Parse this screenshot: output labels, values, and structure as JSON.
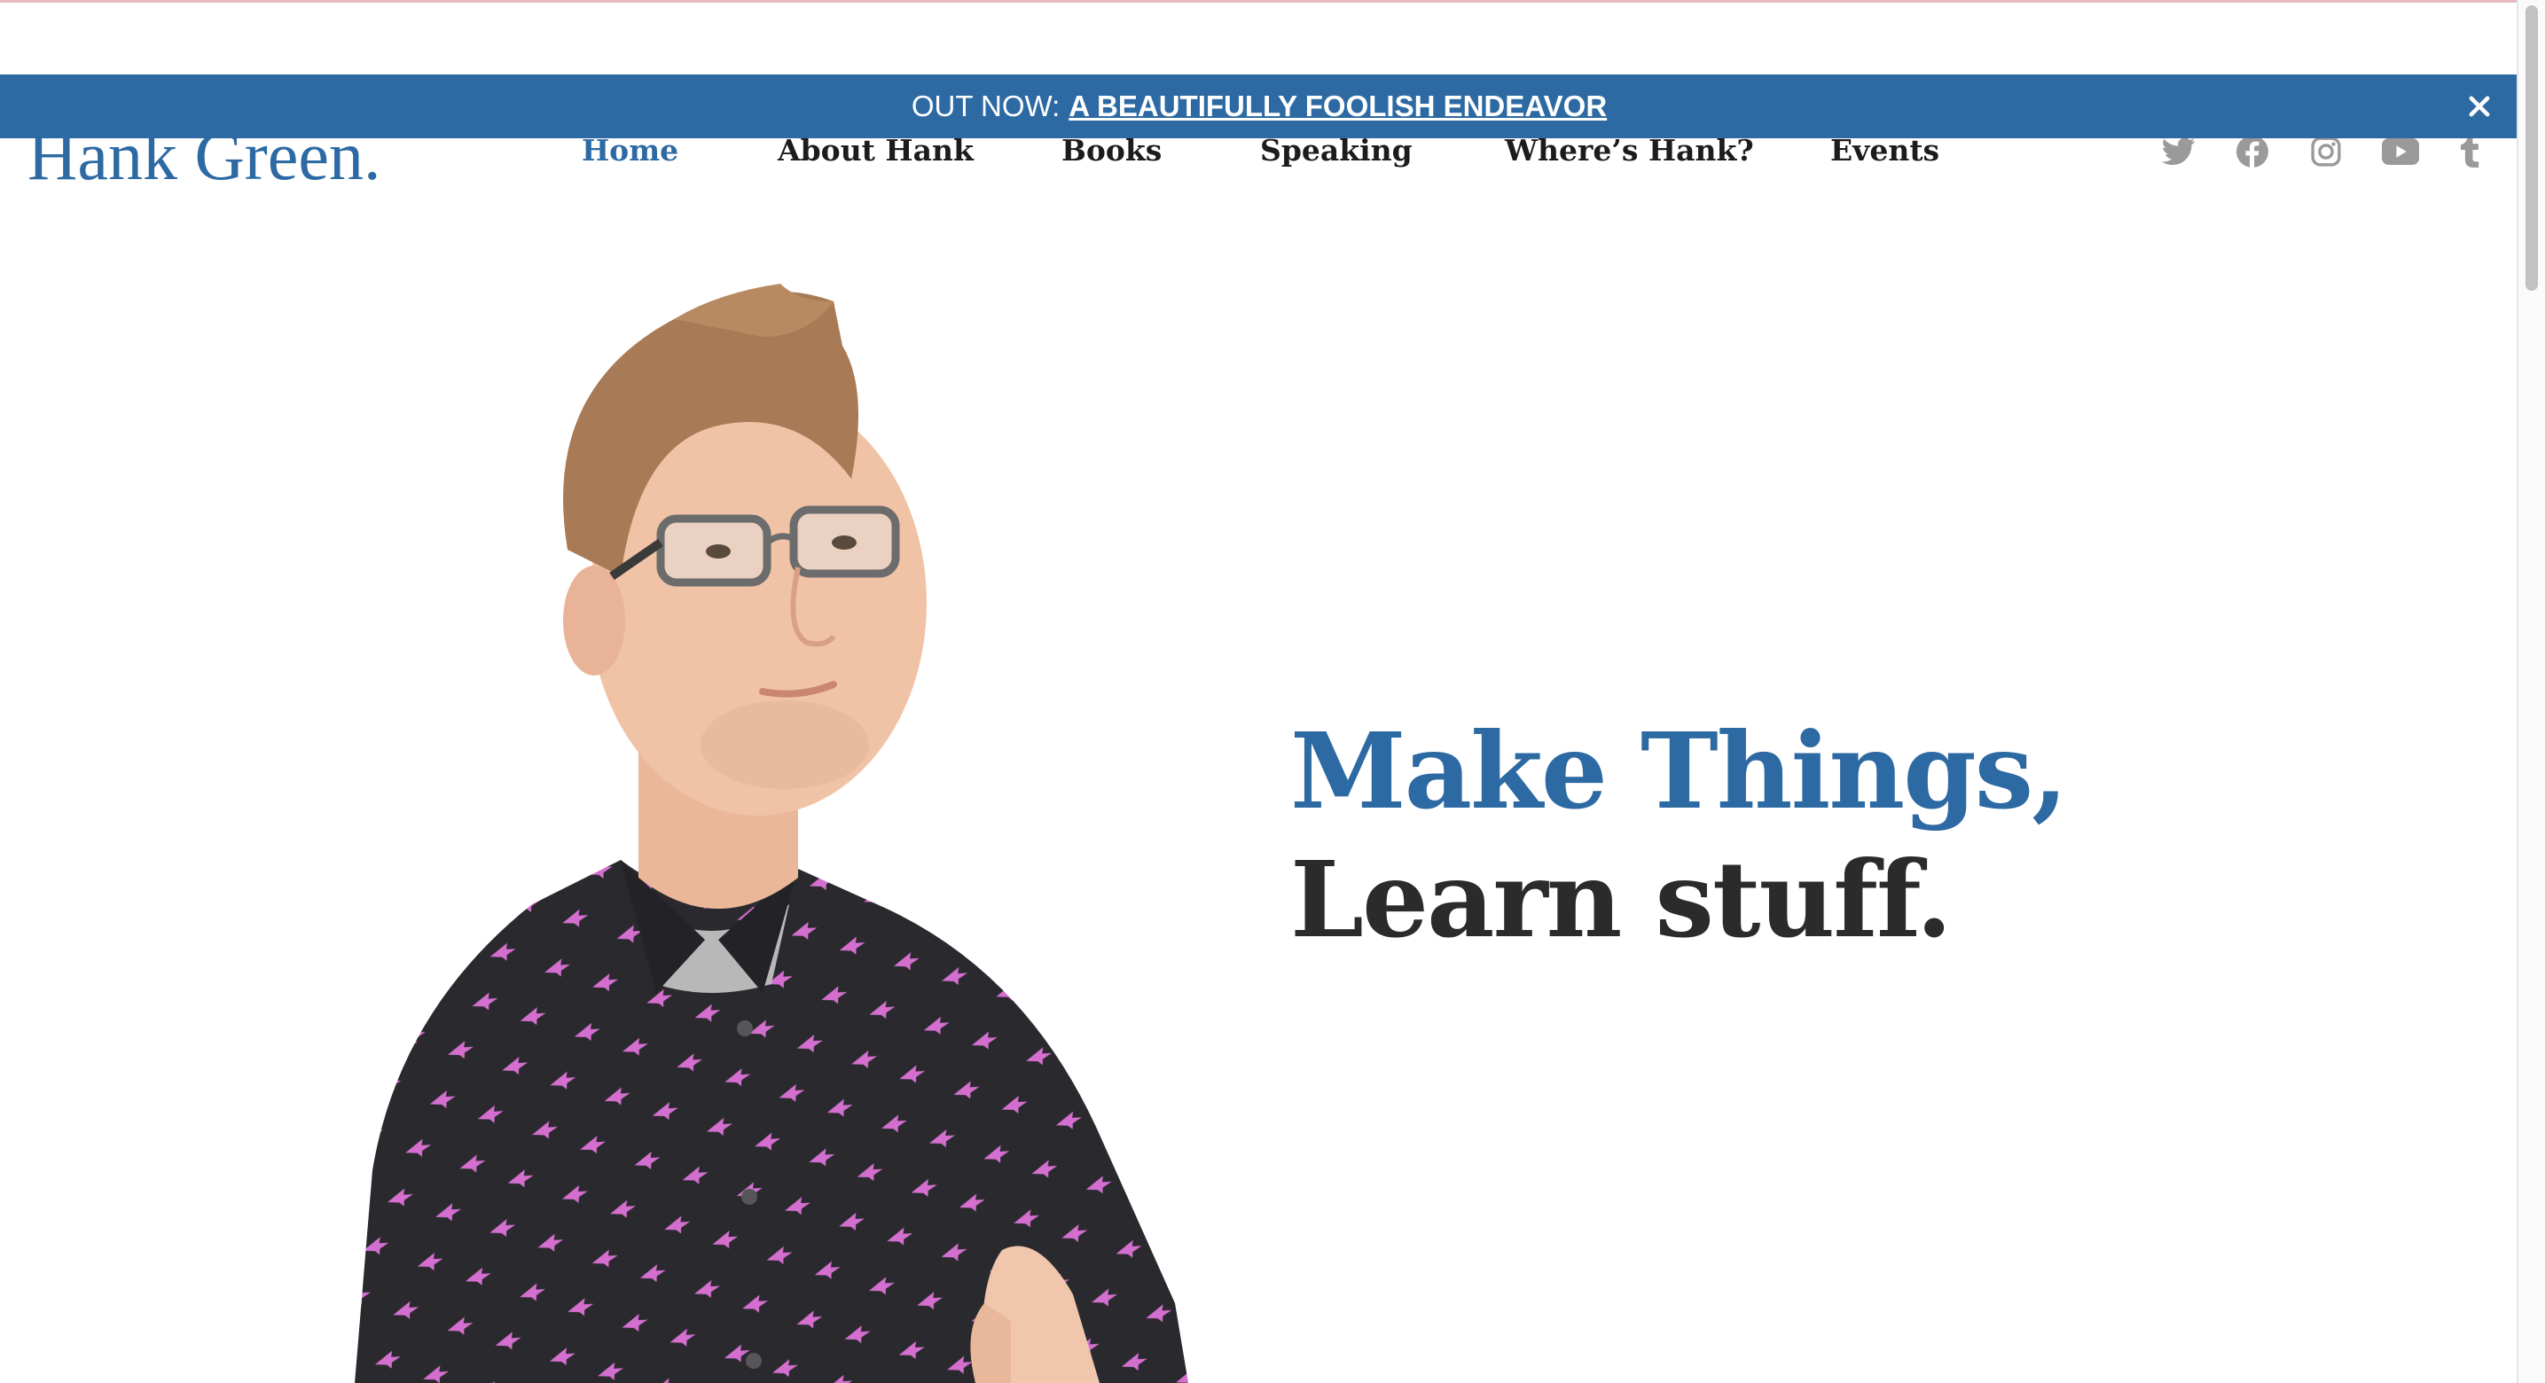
{
  "site": {
    "logo_text": "Hank Green."
  },
  "nav": {
    "items": [
      {
        "label": "Home",
        "active": true
      },
      {
        "label": "About Hank",
        "active": false
      },
      {
        "label": "Books",
        "active": false
      },
      {
        "label": "Speaking",
        "active": false
      },
      {
        "label": "Where’s Hank?",
        "active": false
      },
      {
        "label": "Events",
        "active": false
      }
    ]
  },
  "social": [
    {
      "icon": "twitter-icon"
    },
    {
      "icon": "facebook-icon"
    },
    {
      "icon": "instagram-icon"
    },
    {
      "icon": "youtube-icon"
    },
    {
      "icon": "tumblr-icon"
    }
  ],
  "banner": {
    "prefix": "OUT NOW:",
    "link_text": "A BEAUTIFULLY FOOLISH ENDEAVOR",
    "close_icon": "close-icon"
  },
  "hero": {
    "headline_line1": "Make Things,",
    "headline_line2": "Learn stuff."
  },
  "colors": {
    "brand_blue": "#2d6aa3",
    "text_dark": "#2b2b2b",
    "social_gray": "#9a9a9a",
    "shirt": "#2a2a2e",
    "shirt_pattern": "#d46fd0"
  }
}
